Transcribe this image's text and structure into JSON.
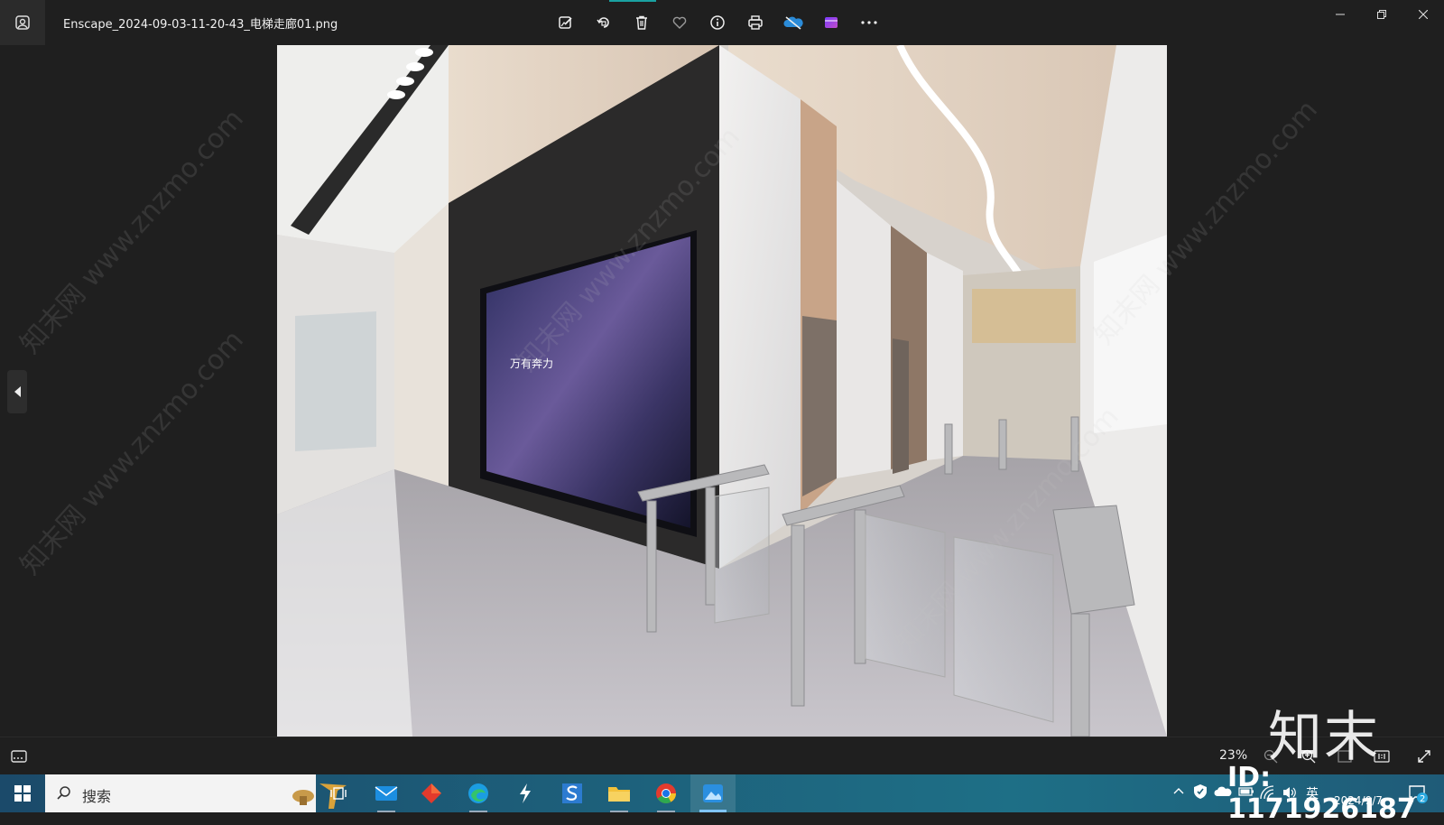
{
  "window": {
    "file_title": "Enscape_2024-09-03-11-20-43_电梯走廊01.png"
  },
  "toolbar": {
    "items": [
      {
        "icon": "edit-image-icon"
      },
      {
        "icon": "rotate-icon"
      },
      {
        "icon": "delete-icon"
      },
      {
        "icon": "heart-icon"
      },
      {
        "icon": "info-icon"
      },
      {
        "icon": "print-icon"
      },
      {
        "icon": "onedrive-icon"
      },
      {
        "icon": "clipchamp-icon"
      },
      {
        "icon": "more-icon"
      }
    ]
  },
  "window_controls": [
    "minimize-icon",
    "restore-icon",
    "close-icon"
  ],
  "image": {
    "screen_text": "万有奔力"
  },
  "bottombar": {
    "zoom": "23%"
  },
  "taskbar": {
    "search_placeholder": "搜索",
    "apps": [
      "task-view-icon",
      "mail-icon",
      "app-red-icon",
      "edge-icon",
      "app-bolt-icon",
      "app-s-icon",
      "file-explorer-icon",
      "chrome-icon",
      "photos-icon"
    ],
    "tray_lang": "英",
    "date": "2024/9/7",
    "notification_count": "2"
  },
  "watermark": {
    "brand": "知末",
    "id": "ID: 1171926187",
    "diag_text": "知末网 www.znzmo.com"
  },
  "colors": {
    "accent": "#1aa1a1",
    "taskbar": "#1d5f7a",
    "background": "#1f1f1f"
  }
}
